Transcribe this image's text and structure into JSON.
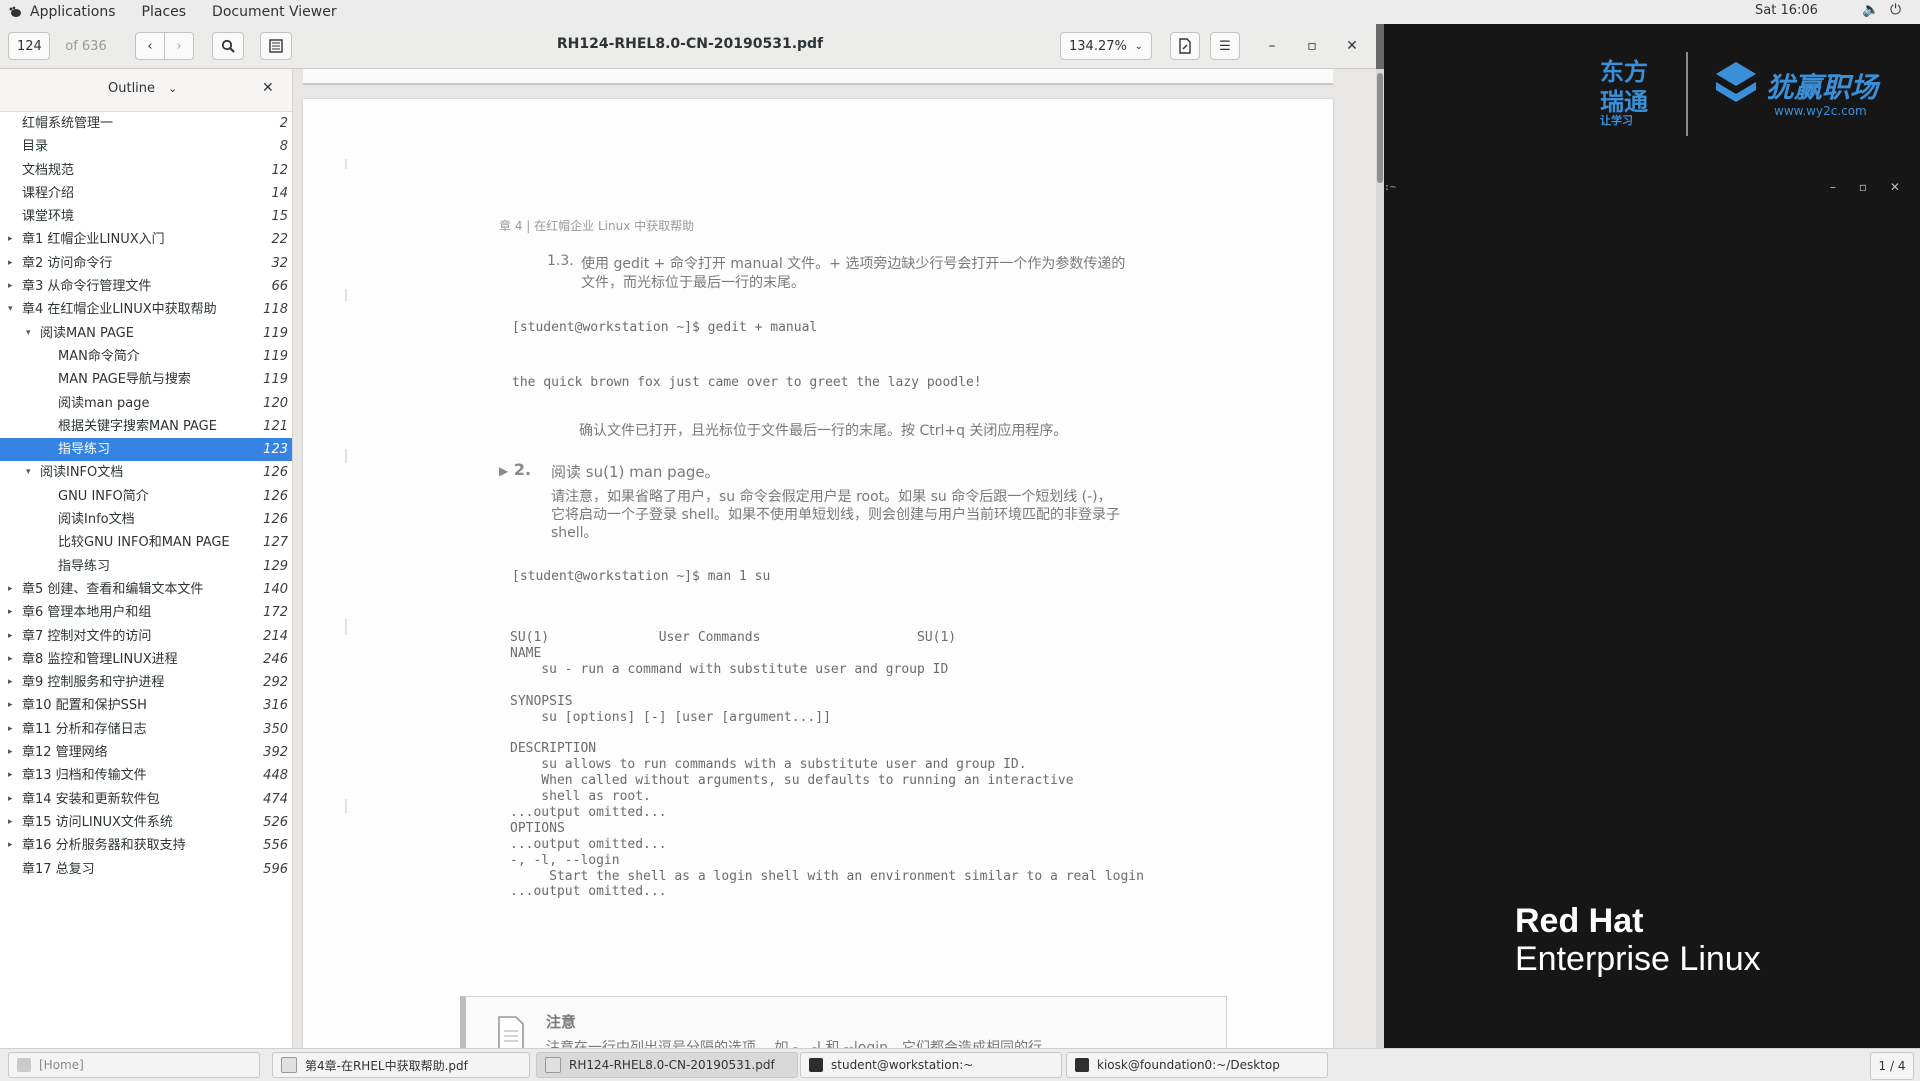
{
  "topbar": {
    "applications": "Applications",
    "places": "Places",
    "app_name": "Document Viewer",
    "clock": "Sat 16:06"
  },
  "toolbar": {
    "page_value": "124",
    "page_of": "of 636",
    "title": "RH124-RHEL8.0-CN-20190531.pdf",
    "zoom": "134.27%"
  },
  "sidebar": {
    "mode_label": "Outline",
    "items": [
      {
        "title": "红帽系统管理一",
        "page": "2",
        "level": 0,
        "expander": ""
      },
      {
        "title": "目录",
        "page": "8",
        "level": 0,
        "expander": ""
      },
      {
        "title": "文档规范",
        "page": "12",
        "level": 0,
        "expander": ""
      },
      {
        "title": "课程介绍",
        "page": "14",
        "level": 0,
        "expander": ""
      },
      {
        "title": "课堂环境",
        "page": "15",
        "level": 0,
        "expander": ""
      },
      {
        "title": "章1 红帽企业LINUX入门",
        "page": "22",
        "level": 0,
        "expander": "▸"
      },
      {
        "title": "章2 访问命令行",
        "page": "32",
        "level": 0,
        "expander": "▸"
      },
      {
        "title": "章3 从命令行管理文件",
        "page": "66",
        "level": 0,
        "expander": "▸"
      },
      {
        "title": "章4 在红帽企业LINUX中获取帮助",
        "page": "118",
        "level": 0,
        "expander": "▾"
      },
      {
        "title": "阅读MAN PAGE",
        "page": "119",
        "level": 1,
        "expander": "▾"
      },
      {
        "title": "MAN命令简介",
        "page": "119",
        "level": 2,
        "expander": ""
      },
      {
        "title": "MAN PAGE导航与搜索",
        "page": "119",
        "level": 2,
        "expander": ""
      },
      {
        "title": "阅读man page",
        "page": "120",
        "level": 2,
        "expander": ""
      },
      {
        "title": "根据关键字搜索MAN PAGE",
        "page": "121",
        "level": 2,
        "expander": ""
      },
      {
        "title": "指导练习",
        "page": "123",
        "level": 2,
        "expander": "",
        "selected": true
      },
      {
        "title": "阅读INFO文档",
        "page": "126",
        "level": 1,
        "expander": "▾"
      },
      {
        "title": "GNU INFO简介",
        "page": "126",
        "level": 2,
        "expander": ""
      },
      {
        "title": "阅读Info文档",
        "page": "126",
        "level": 2,
        "expander": ""
      },
      {
        "title": "比较GNU INFO和MAN PAGE...",
        "page": "127",
        "level": 2,
        "expander": ""
      },
      {
        "title": "指导练习",
        "page": "129",
        "level": 2,
        "expander": ""
      },
      {
        "title": "章5 创建、查看和编辑文本文件",
        "page": "140",
        "level": 0,
        "expander": "▸"
      },
      {
        "title": "章6 管理本地用户和组",
        "page": "172",
        "level": 0,
        "expander": "▸"
      },
      {
        "title": "章7 控制对文件的访问",
        "page": "214",
        "level": 0,
        "expander": "▸"
      },
      {
        "title": "章8 监控和管理LINUX进程",
        "page": "246",
        "level": 0,
        "expander": "▸"
      },
      {
        "title": "章9 控制服务和守护进程",
        "page": "292",
        "level": 0,
        "expander": "▸"
      },
      {
        "title": "章10 配置和保护SSH",
        "page": "316",
        "level": 0,
        "expander": "▸"
      },
      {
        "title": "章11 分析和存储日志",
        "page": "350",
        "level": 0,
        "expander": "▸"
      },
      {
        "title": "章12 管理网络",
        "page": "392",
        "level": 0,
        "expander": "▸"
      },
      {
        "title": "章13 归档和传输文件",
        "page": "448",
        "level": 0,
        "expander": "▸"
      },
      {
        "title": "章14 安装和更新软件包",
        "page": "474",
        "level": 0,
        "expander": "▸"
      },
      {
        "title": "章15 访问LINUX文件系统",
        "page": "526",
        "level": 0,
        "expander": "▸"
      },
      {
        "title": "章16 分析服务器和获取支持",
        "page": "556",
        "level": 0,
        "expander": "▸"
      },
      {
        "title": "章17 总复习",
        "page": "596",
        "level": 0,
        "expander": ""
      }
    ]
  },
  "document": {
    "running_header_chapter": "章 4",
    "running_header_sep": "|",
    "running_header_title": "在红帽企业 Linux 中获取帮助",
    "step13_num": "1.3.",
    "step13_line1": "使用 gedit + 命令打开 manual 文件。+ 选项旁边缺少行号会打开一个作为参数传递的",
    "step13_line2": "文件，而光标位于最后一行的末尾。",
    "cmd1": "[student@workstation ~]$ gedit + manual",
    "fox_line": "the quick brown fox just came over to greet the lazy poodle!",
    "confirm_line": "确认文件已打开，且光标位于文件最后一行的末尾。按 Ctrl+q 关闭应用程序。",
    "step2_num": "2.",
    "step2_title": "阅读 su(1) man page。",
    "step2_p1": "请注意，如果省略了用户，su 命令会假定用户是 root。如果 su 命令后跟一个短划线 (-)，",
    "step2_p2": "它将启动一个子登录 shell。如果不使用单短划线，则会创建与用户当前环境匹配的非登录子",
    "step2_p3": "shell。",
    "cmd2": "[student@workstation ~]$ man 1 su",
    "man_lines": [
      "SU(1)              User Commands                    SU(1)",
      "NAME",
      "    su - run a command with substitute user and group ID",
      "",
      "SYNOPSIS",
      "    su [options] [-] [user [argument...]]",
      "",
      "DESCRIPTION",
      "    su allows to run commands with a substitute user and group ID.",
      "    When called without arguments, su defaults to running an interactive",
      "    shell as root.",
      "...output omitted...",
      "OPTIONS",
      "...output omitted...",
      "-, -l, --login",
      "     Start the shell as a login shell with an environment similar to a real login",
      "...output omitted..."
    ],
    "note_title": "注意",
    "note_text": "注意在一行中列出逗号分隔的选项， 如 -、-l 和 --login，它们都会造成相同的行"
  },
  "right_panel": {
    "logo_left_line1": "东方",
    "logo_left_line2": "瑞通",
    "logo_left_line3": "让学习",
    "logo_right_name": "犹赢职场",
    "logo_right_url": "www.wy2c.com",
    "term_fragment": "l:~",
    "rh_line1": "Red Hat",
    "rh_line2": "Enterprise Linux"
  },
  "taskbar": {
    "home": "[Home]",
    "task1": "第4章-在RHEL中获取帮助.pdf",
    "task2": "RH124-RHEL8.0-CN-20190531.pdf",
    "task3": "student@workstation:~",
    "task4": "kiosk@foundation0:~/Desktop",
    "workspace": "1 / 4"
  },
  "colors": {
    "selection": "#3584e4",
    "logo_blue": "#3b8fd6"
  }
}
